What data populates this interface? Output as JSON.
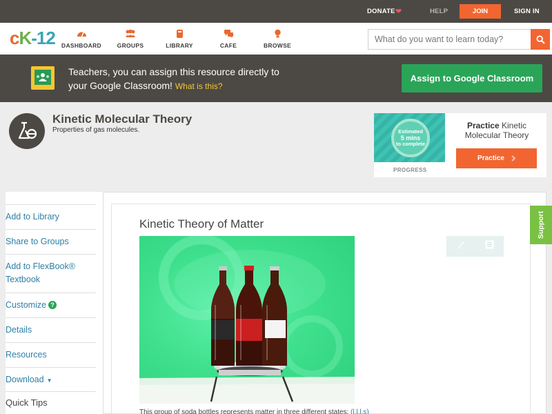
{
  "topbar": {
    "donate": "DONATE",
    "help": "HELP",
    "join": "JOIN",
    "signin": "SIGN IN"
  },
  "logo": {
    "c": "c",
    "k": "K",
    "n": "-12"
  },
  "nav": [
    {
      "label": "DASHBOARD",
      "icon": "dashboard-icon"
    },
    {
      "label": "GROUPS",
      "icon": "groups-icon"
    },
    {
      "label": "LIBRARY",
      "icon": "library-icon"
    },
    {
      "label": "CAFE",
      "icon": "cafe-icon"
    },
    {
      "label": "BROWSE",
      "icon": "browse-icon"
    }
  ],
  "search": {
    "placeholder": "What do you want to learn today?"
  },
  "banner": {
    "line1": "Teachers, you can assign this resource directly to",
    "line2": "your Google Classroom!",
    "what": "What is this?",
    "assign_button": "Assign to Google Classroom"
  },
  "concept": {
    "title": "Kinetic Molecular Theory",
    "subtitle": "Properties of gas molecules."
  },
  "practice": {
    "estimated": "Estimated",
    "mins": "5 mins",
    "to_complete": "to complete",
    "progress_label": "PROGRESS",
    "label_bold": "Practice",
    "label_rest": "Kinetic Molecular Theory",
    "button": "Practice"
  },
  "sidebar": {
    "items": [
      {
        "label": "Add to Library"
      },
      {
        "label": "Share to Groups"
      },
      {
        "label": "Add to FlexBook® Textbook"
      },
      {
        "label": "Customize"
      },
      {
        "label": "Details"
      },
      {
        "label": "Resources"
      },
      {
        "label": "Download"
      }
    ],
    "quick_tips": "Quick Tips"
  },
  "article": {
    "title": "Kinetic Theory of Matter",
    "bottom_text_start": "This group of soda bottles represents matter in three different states:",
    "bottom_text_link": "(l,l,l,s)"
  },
  "support": "Support",
  "colors": {
    "accent": "#f26531",
    "green": "#2aa558",
    "dark": "#4c4944",
    "link": "#2f7fa6"
  }
}
